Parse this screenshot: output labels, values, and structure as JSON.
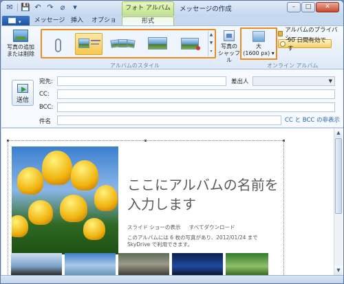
{
  "titlebar": {
    "context_tab_header": "フォト アルバム ツール",
    "window_title": "メッセージの作成",
    "minimize": "–",
    "maximize": "□",
    "close": "✕"
  },
  "tabs": [
    {
      "label": "メッセージ"
    },
    {
      "label": "挿入"
    },
    {
      "label": "オプション"
    },
    {
      "label": "形式"
    }
  ],
  "ribbon": {
    "add_photos_label": "写真の追加\nまたは削除",
    "album_style_group": "アルバムのスタイル",
    "shuffle_label": "写真の\nシャッフル",
    "size_label": "大",
    "size_value": "(1600 px) ▾",
    "privacy_label": "アルバムのプライバシー",
    "validity_button": "90 日間有効です",
    "online_album_group": "オンライン アルバム",
    "gallery_up": "▲",
    "gallery_down": "▼",
    "gallery_more": "▾"
  },
  "form": {
    "send_label": "送信",
    "to_label": "宛先:",
    "from_label": "差出人",
    "from_caret": "▼",
    "cc_label": "CC:",
    "bcc_label": "BCC:",
    "subject_label": "件名",
    "cc_bcc_toggle": "CC と BCC の非表示"
  },
  "album": {
    "title_line1": "ここにアルバムの名前を",
    "title_line2": "入力します",
    "slideshow_link": "スライド ショーの表示",
    "download_link": "すべてダウンロード",
    "description": "このアルバムには 6 枚の写真があり、2012/01/24 まで SkyDrive で利用できます。"
  },
  "scrollbar": {
    "up": "▲",
    "down": "▼"
  },
  "colors": {
    "highlight_orange": "#f08a1f",
    "context_tab_green": "#bfe08a",
    "link_blue": "#1f64b9"
  }
}
